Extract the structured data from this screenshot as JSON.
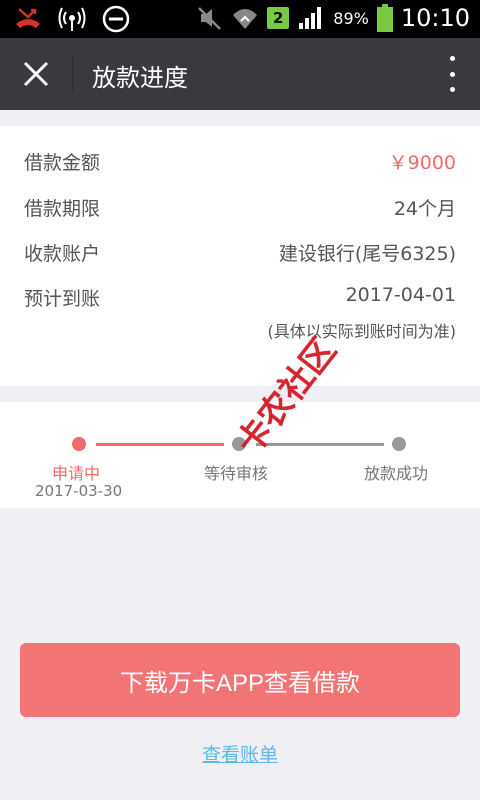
{
  "status_bar": {
    "battery_percent": "89%",
    "time": "10:10",
    "sim_label": "2",
    "icons": [
      "missed-call-icon",
      "wifi-hotspot-icon",
      "do-not-disturb-icon",
      "mute-icon",
      "wifi-icon",
      "signal-icon",
      "battery-icon"
    ]
  },
  "header": {
    "title": "放款进度",
    "close_icon": "close-icon",
    "more_icon": "more-vertical-icon"
  },
  "loan_info": {
    "rows": [
      {
        "label": "借款金额",
        "value": "￥9000"
      },
      {
        "label": "借款期限",
        "value": "24个月"
      },
      {
        "label": "收款账户",
        "value": "建设银行(尾号6325)"
      },
      {
        "label": "预计到账",
        "value": "2017-04-01"
      }
    ],
    "note": "(具体以实际到账时间为准)"
  },
  "progress": {
    "steps": [
      {
        "label": "申请中",
        "date": "2017-03-30",
        "active": true
      },
      {
        "label": "等待审核",
        "date": "",
        "active": false
      },
      {
        "label": "放款成功",
        "date": "",
        "active": false
      }
    ]
  },
  "watermark": {
    "text": "卡农社区"
  },
  "actions": {
    "download_label": "下载万卡APP查看借款",
    "bill_link_label": "查看账单"
  },
  "colors": {
    "accent": "#f06a6a",
    "button": "#f27474",
    "header_bg": "#393a3e",
    "link": "#5cb8e6",
    "inactive": "#999999"
  }
}
